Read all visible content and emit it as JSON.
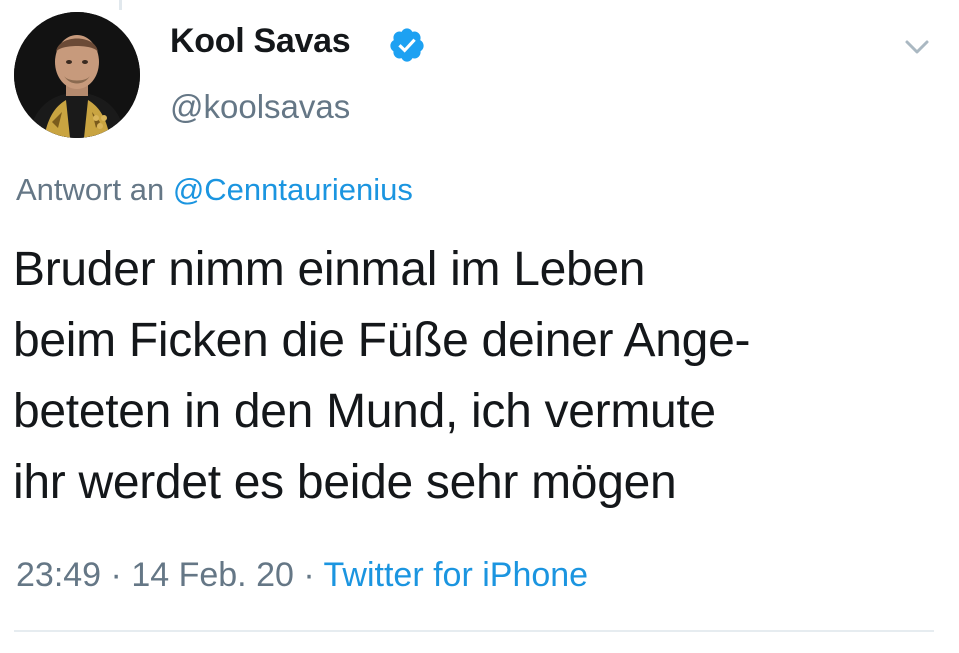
{
  "tweet": {
    "author": {
      "display_name": "Kool Savas",
      "handle": "@koolsavas",
      "verified": true,
      "avatar_icon": "profile-photo"
    },
    "reply_to": {
      "prefix": "Antwort an",
      "mention": "@Cenntaurienius"
    },
    "text_lines": [
      "Bruder nimm einmal im Leben",
      "beim Ficken die Füße deiner Ange-",
      "beteten in den Mund, ich vermute",
      "ihr werdet es beide sehr mögen"
    ],
    "meta": {
      "time": "23:49",
      "separator": "·",
      "date": "14 Feb. 20",
      "source": "Twitter for iPhone"
    }
  },
  "colors": {
    "text": "#14171a",
    "secondary": "#657786",
    "link": "#1b95e0",
    "verified": "#1da1f2",
    "divider": "#e6ecf0"
  },
  "icons": {
    "verified": "verified-badge-icon",
    "menu": "chevron-down-icon"
  }
}
